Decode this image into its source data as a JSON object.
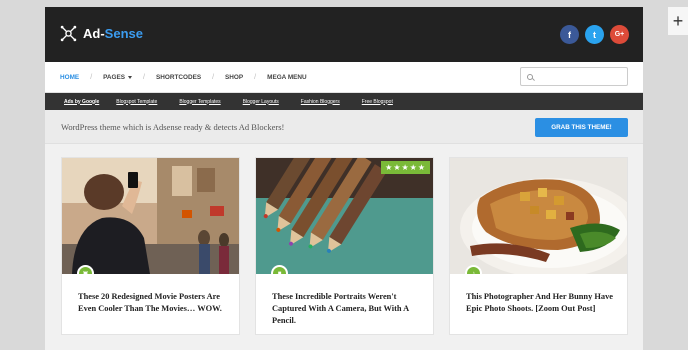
{
  "header": {
    "logo_prefix": "Ad-",
    "logo_accent": "Sense",
    "socials": [
      {
        "name": "facebook",
        "glyph": "f",
        "color": "#3b5998"
      },
      {
        "name": "twitter",
        "glyph": "t",
        "color": "#2aa3ef"
      },
      {
        "name": "google-plus",
        "glyph": "G+",
        "color": "#dd4b39"
      }
    ]
  },
  "nav": {
    "items": [
      "HOME",
      "PAGES",
      "SHORTCODES",
      "SHOP",
      "MEGA MENU"
    ],
    "search_placeholder": ""
  },
  "adbar": {
    "links": [
      "Ads by Google",
      "Blogspot Template",
      "Blogger Templates",
      "Blogger Layouts",
      "Fashion Bloggers",
      "Free Blogspot"
    ]
  },
  "promo": {
    "text": "WordPress theme which is Adsense ready & detects Ad Blockers!",
    "button": "GRAB THIS THEME!"
  },
  "cards": [
    {
      "title": "These 20 Redesigned Movie Posters Are Even Cooler Than The Movies… WOW.",
      "icon": "image-icon"
    },
    {
      "title": "These Incredible Portraits Weren't Captured With A Camera, But With A Pencil.",
      "icon": "video-icon",
      "rating_stars": 5
    },
    {
      "title": "This Photographer And Her Bunny Have Epic Photo Shoots. [Zoom Out Post]",
      "icon": "audio-icon"
    }
  ],
  "colors": {
    "accent": "#2b8fe3",
    "badge_green": "#7ab938",
    "header_bg": "#222222"
  }
}
